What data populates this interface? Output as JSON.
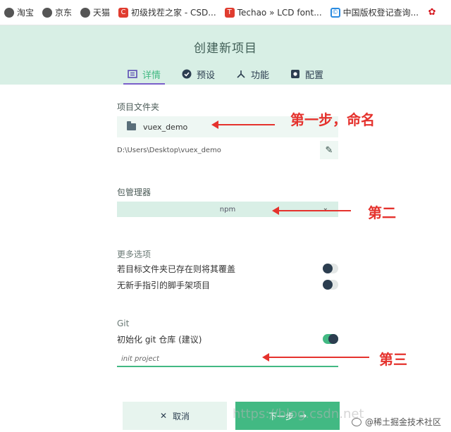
{
  "bookmarks": [
    {
      "label": "淘宝",
      "icon": "globe-icon"
    },
    {
      "label": "京东",
      "icon": "globe-icon"
    },
    {
      "label": "天猫",
      "icon": "globe-icon"
    },
    {
      "label": "初级找茬之家 - CSD...",
      "icon": "csdn-icon"
    },
    {
      "label": "Techao » LCD font...",
      "icon": "techao-icon"
    },
    {
      "label": "中国版权登记查询...",
      "icon": "copyright-icon"
    },
    {
      "label": "",
      "icon": "huawei-icon"
    }
  ],
  "header": {
    "title": "创建新项目",
    "tabs": [
      {
        "label": "详情",
        "icon": "details-icon",
        "active": true
      },
      {
        "label": "预设",
        "icon": "check-circle-icon",
        "active": false
      },
      {
        "label": "功能",
        "icon": "features-icon",
        "active": false
      },
      {
        "label": "配置",
        "icon": "config-icon",
        "active": false
      }
    ]
  },
  "form": {
    "folder_label": "项目文件夹",
    "folder_value": "vuex_demo",
    "path_value": "D:\\Users\\Desktop\\vuex_demo",
    "pm_label": "包管理器",
    "pm_value": "npm",
    "more_title": "更多选项",
    "overwrite_label": "若目标文件夹已存在则将其覆盖",
    "no_guide_label": "无新手指引的脚手架项目",
    "git_title": "Git",
    "git_init_label": "初始化 git 仓库 (建议)",
    "commit_placeholder": "init project"
  },
  "toggles": {
    "overwrite": false,
    "no_guide": false,
    "git_init": true
  },
  "buttons": {
    "cancel": "取消",
    "next": "下一步"
  },
  "annotations": {
    "step1": "第一步，命名",
    "step2": "第二",
    "step3": "第三"
  },
  "colors": {
    "accent": "#42b983",
    "header_bg": "#d8efe5",
    "annotation": "#e5322d"
  },
  "watermark": "https://blog.csdn.net",
  "credit": "@稀土掘金技术社区"
}
